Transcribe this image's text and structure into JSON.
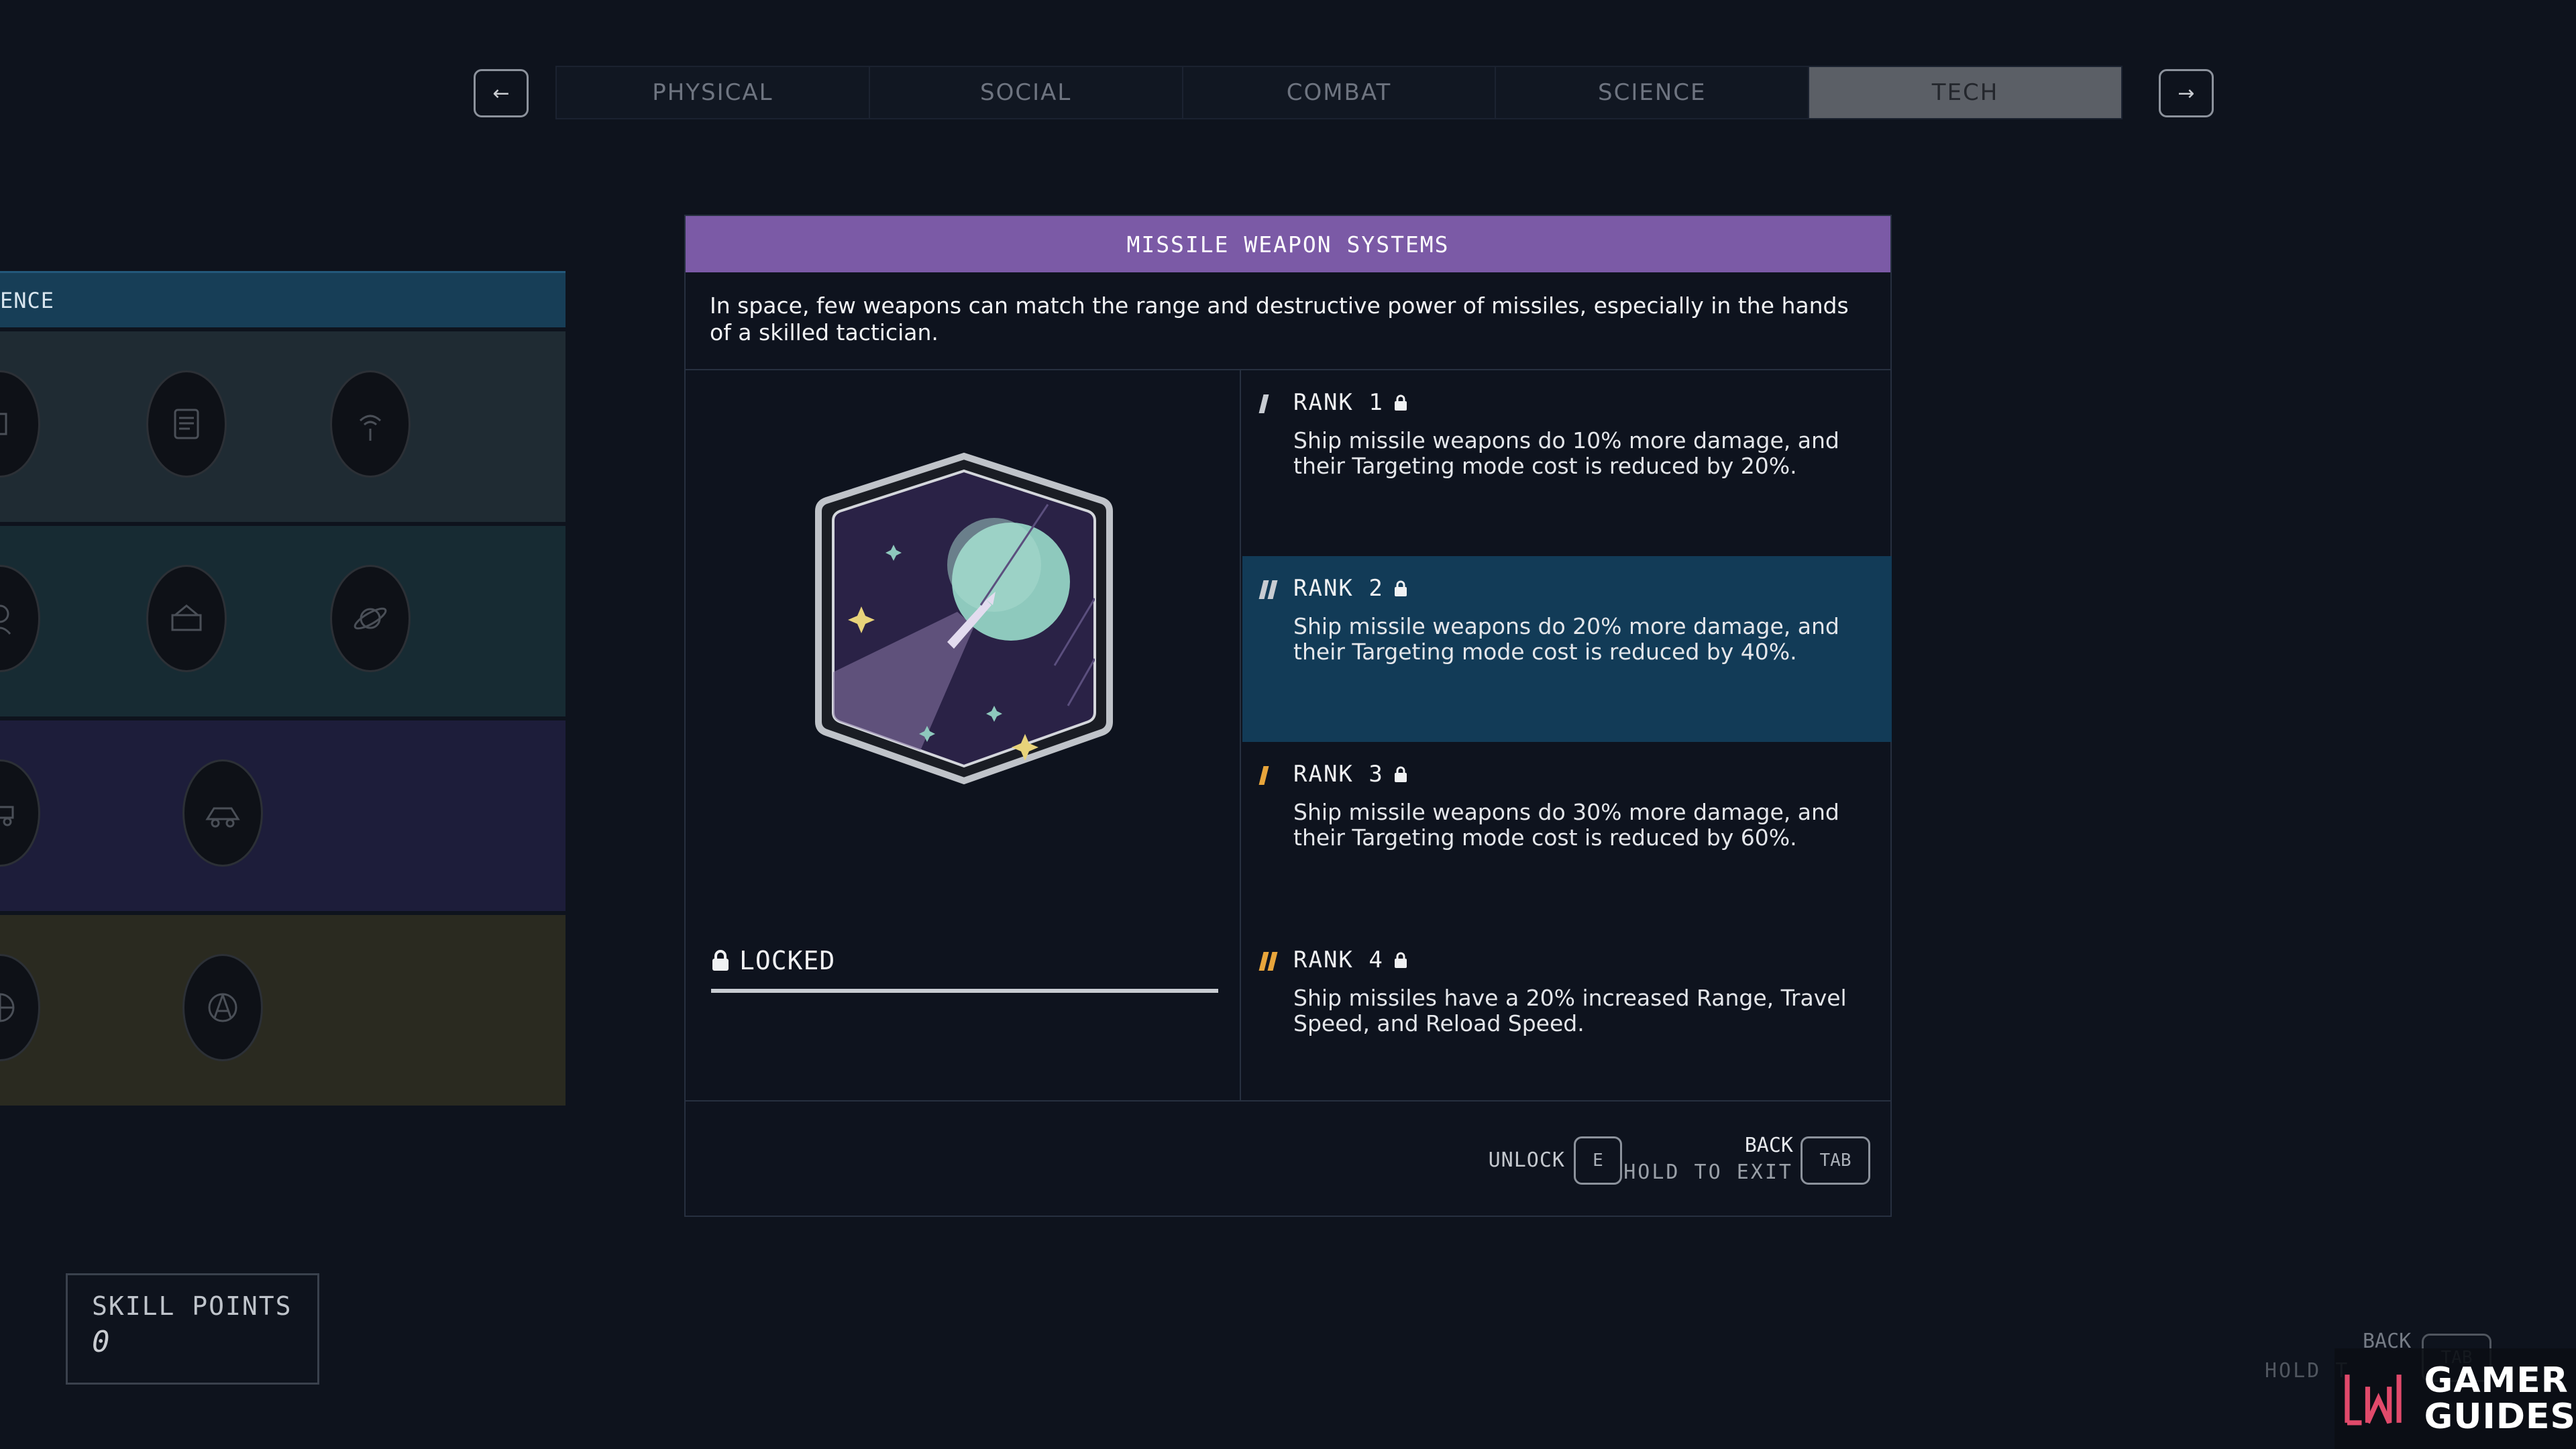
{
  "nav": {
    "prev_icon": "←",
    "next_icon": "→",
    "tabs": [
      {
        "label": "PHYSICAL",
        "active": false
      },
      {
        "label": "SOCIAL",
        "active": false
      },
      {
        "label": "COMBAT",
        "active": false
      },
      {
        "label": "SCIENCE",
        "active": false
      },
      {
        "label": "TECH",
        "active": true
      }
    ]
  },
  "tree": {
    "category_partial": "ENCE",
    "tiers": [
      {
        "icons": [
          "fist-icon",
          "document-icon",
          "signal-icon"
        ]
      },
      {
        "icons": [
          "astronaut-icon",
          "weapon-crate-icon",
          "planet-icon"
        ]
      },
      {
        "icons": [
          "rover-icon",
          "vehicle-icon"
        ]
      },
      {
        "icons": [
          "globe-icon",
          "compass-icon"
        ]
      }
    ]
  },
  "panel": {
    "title": "MISSILE WEAPON SYSTEMS",
    "description": "In space, few weapons can match the range and destructive power of missiles, especially in the hands of a skilled tactician.",
    "status": "LOCKED",
    "progress": 0,
    "ranks": [
      {
        "label": "RANK 1",
        "marks": 1,
        "color": "#c8ccd2",
        "active": false,
        "description": "Ship missile weapons do 10% more damage, and their Targeting mode cost is reduced by 20%."
      },
      {
        "label": "RANK 2",
        "marks": 2,
        "color": "#c8ccd2",
        "active": true,
        "description": "Ship missile weapons do 20% more damage, and their Targeting mode cost is reduced by 40%."
      },
      {
        "label": "RANK 3",
        "marks": 1,
        "color": "#e8a53b",
        "active": false,
        "description": "Ship missile weapons do 30% more damage, and their Targeting mode cost is reduced by 60%."
      },
      {
        "label": "RANK 4",
        "marks": 2,
        "color": "#e8a53b",
        "active": false,
        "description": "Ship missiles have a 20% increased Range, Travel Speed, and Reload Speed."
      }
    ],
    "footer": {
      "unlock_label": "UNLOCK",
      "unlock_key": "E",
      "back_label": "BACK",
      "hold_label": "HOLD TO EXIT",
      "tab_key": "TAB"
    }
  },
  "skill_points": {
    "label": "SKILL POINTS",
    "value": "0"
  },
  "ghost_prompt": {
    "back_label": "BACK",
    "hold_label": "HOLD T",
    "key": "TAB"
  },
  "watermark": {
    "line1": "GAMER",
    "line2": "GUIDES"
  },
  "colors": {
    "title_bar": "#7b5aa6",
    "active_rank": "#123b57",
    "rank_orange": "#e8a53b"
  }
}
